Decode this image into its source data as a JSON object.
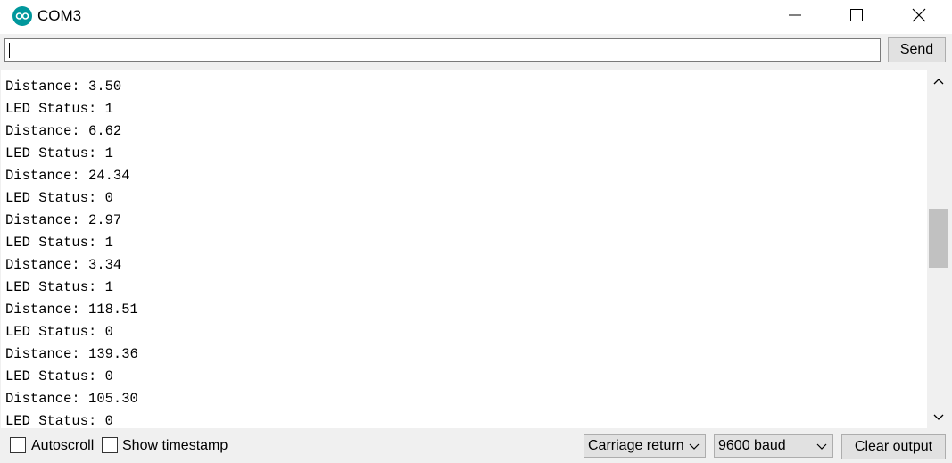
{
  "window": {
    "title": "COM3",
    "accent_color": "#00979c",
    "icons": [
      "arduino-logo-icon",
      "minimize-icon",
      "maximize-icon",
      "close-icon"
    ]
  },
  "send_bar": {
    "input_value": "",
    "send_label": "Send"
  },
  "output": {
    "lines": [
      "Distance: 3.50",
      "LED Status: 1",
      "Distance: 6.62",
      "LED Status: 1",
      "Distance: 24.34",
      "LED Status: 0",
      "Distance: 2.97",
      "LED Status: 1",
      "Distance: 3.34",
      "LED Status: 1",
      "Distance: 118.51",
      "LED Status: 0",
      "Distance: 139.36",
      "LED Status: 0",
      "Distance: 105.30",
      "LED Status: 0"
    ]
  },
  "status_bar": {
    "autoscroll_label": "Autoscroll",
    "autoscroll_checked": false,
    "timestamp_label": "Show timestamp",
    "timestamp_checked": false,
    "line_ending_selected": "Carriage return",
    "baud_selected": "9600 baud",
    "clear_label": "Clear output"
  }
}
